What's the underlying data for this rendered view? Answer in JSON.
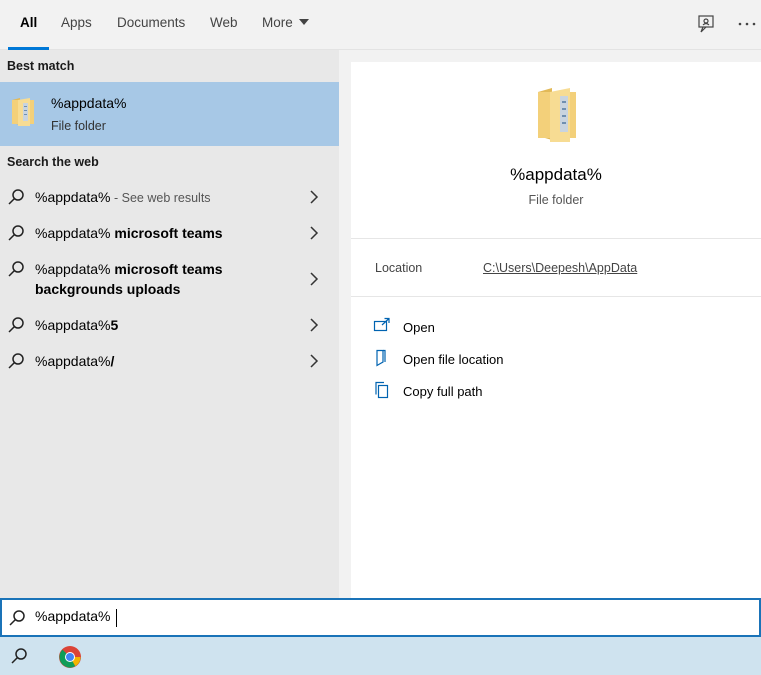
{
  "tabs": [
    {
      "label": "All",
      "active": true
    },
    {
      "label": "Apps"
    },
    {
      "label": "Documents"
    },
    {
      "label": "Web"
    },
    {
      "label": "More"
    }
  ],
  "toolbar": {
    "feedback_icon": "feedback-icon",
    "more_icon": "ellipsis-icon"
  },
  "best_match": {
    "heading": "Best match",
    "title": "%appdata%",
    "subtitle": "File folder",
    "icon": "folder-icon"
  },
  "web": {
    "heading": "Search the web",
    "results": [
      {
        "prefix": "%appdata%",
        "bold": "",
        "suffix": " - See web results"
      },
      {
        "prefix": "%appdata% ",
        "bold": "microsoft teams",
        "suffix": ""
      },
      {
        "prefix": "%appdata% ",
        "bold": "microsoft teams backgrounds uploads",
        "suffix": ""
      },
      {
        "prefix": "%appdata%",
        "bold": "5",
        "suffix": ""
      },
      {
        "prefix": "%appdata%",
        "bold": "/",
        "suffix": ""
      }
    ]
  },
  "preview": {
    "title": "%appdata%",
    "subtitle": "File folder",
    "location_label": "Location",
    "location_value": "C:\\Users\\Deepesh\\AppData",
    "actions": [
      {
        "label": "Open",
        "icon": "open-icon"
      },
      {
        "label": "Open file location",
        "icon": "file-location-icon"
      },
      {
        "label": "Copy full path",
        "icon": "copy-icon"
      }
    ]
  },
  "search": {
    "value": "%appdata%"
  },
  "taskbar": {
    "items": [
      "search-icon",
      "chrome-icon"
    ]
  },
  "colors": {
    "accent": "#0078d7",
    "selected": "#a7c8e6",
    "folder": "#f3d07a"
  }
}
